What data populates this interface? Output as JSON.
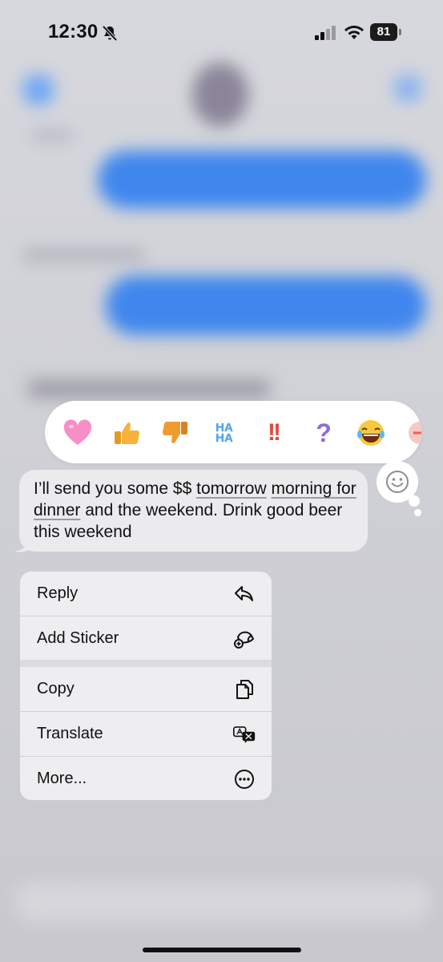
{
  "status_bar": {
    "time": "12:30",
    "battery": "81"
  },
  "reactions": {
    "items": [
      {
        "name": "heart",
        "color": "#f58fc6"
      },
      {
        "name": "thumbs-up",
        "color": "#f6b23a"
      },
      {
        "name": "thumbs-down",
        "color": "#f19a2e"
      },
      {
        "name": "haha",
        "text_top": "HA",
        "text_bottom": "HA",
        "color": "#58a6ee"
      },
      {
        "name": "exclamation",
        "text": "!!",
        "color": "#e24a3b"
      },
      {
        "name": "question",
        "text": "?",
        "color": "#8e6bdc"
      },
      {
        "name": "laughing-face",
        "color": "#f8c93a"
      }
    ]
  },
  "message": {
    "part1": "I’ll send you some $$ ",
    "link1": "tomorrow",
    "link2": "morning for dinner",
    "part2": " and the weekend. Drink good beer this weekend"
  },
  "menu": {
    "items": [
      {
        "label": "Reply",
        "icon": "reply-icon"
      },
      {
        "label": "Add Sticker",
        "icon": "sticker-icon"
      },
      {
        "label": "Copy",
        "icon": "copy-icon"
      },
      {
        "label": "Translate",
        "icon": "translate-icon"
      },
      {
        "label": "More...",
        "icon": "more-icon"
      }
    ]
  },
  "colors": {
    "bubble": "#ebebee",
    "menu_bg": "#eeeef0",
    "reaction_bar": "#ffffff"
  }
}
